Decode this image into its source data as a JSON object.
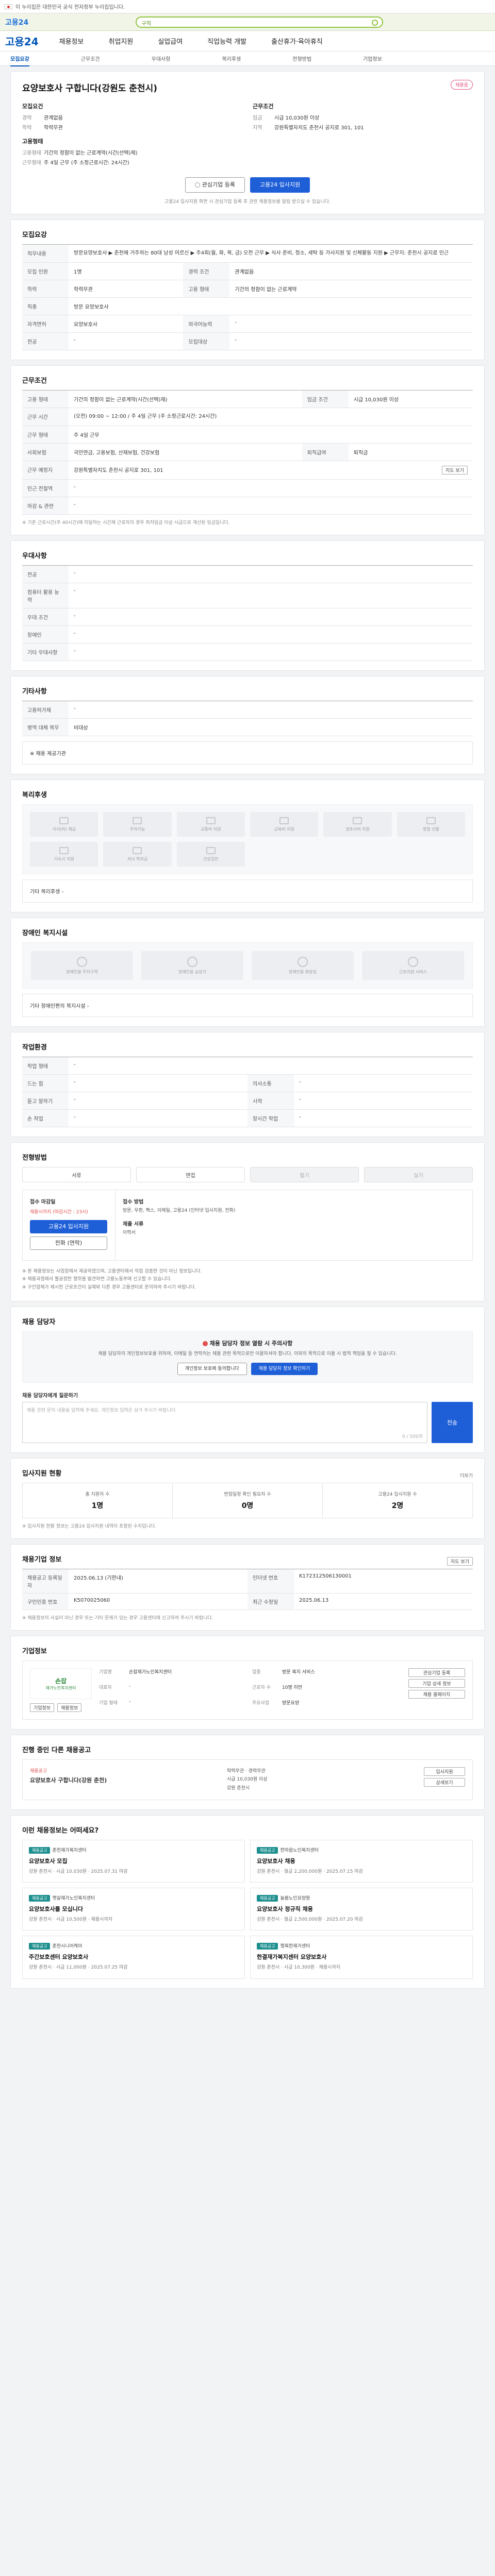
{
  "gov_banner": "이 누리집은 대한민국 공식 전자정부 누리집입니다.",
  "topbar": {
    "logo": "고용24",
    "search_label": "구직"
  },
  "gnb": {
    "logo": "고용24",
    "items": [
      "채용정보",
      "취업지원",
      "실업급여",
      "직업능력 개발",
      "출산휴가·육아휴직"
    ]
  },
  "subnav": {
    "items": [
      "모집요강",
      "근무조건",
      "우대사항",
      "복리후생",
      "전형방법",
      "기업정보"
    ],
    "active_index": 0
  },
  "header": {
    "title": "요양보호사 구합니다(강원도 춘천시)",
    "badge": "채용중",
    "recruit_title": "모집요건",
    "work_title": "근무조건",
    "recruit": [
      {
        "k": "경력",
        "v": "관계없음"
      },
      {
        "k": "학력",
        "v": "학력무관"
      }
    ],
    "work": [
      {
        "k": "임금",
        "v": "시급 10,030원 이상"
      },
      {
        "k": "지역",
        "v": "강원특별자치도 춘천시 공지로 301, 101"
      }
    ],
    "employ_title": "고용형태",
    "employ": [
      {
        "k": "고용형태",
        "v": "기간의 정함이 없는 근로계약(시간(선택)제)"
      },
      {
        "k": "근무형태",
        "v": "주 4일 근무 (주 소정근로시간: 24시간)"
      }
    ],
    "interest_button": "관심기업 등록",
    "apply_button": "고용24 입사지원",
    "note": "고용24 입사지원 화면 시 관심기업 등록 후 관련 채용정보를 알림 받으실 수 있습니다."
  },
  "recruit_section": {
    "title": "모집요강",
    "rows": [
      {
        "k": "직무내용",
        "v": "방문요양보호사 ▶ 춘천에 거주하는 80대 남성 어르신 ▶ 주4회(월, 화, 목, 금) 오전 근무 ▶ 식사 준비, 청소, 세탁 등 가사지원 및 신체활동 지원 ▶ 근무지: 춘천시 공지로 인근"
      },
      {
        "k": "모집 인원",
        "v": "1명"
      },
      {
        "k": "경력 조건",
        "v": "관계없음"
      },
      {
        "k": "학력",
        "v": "학력무관"
      },
      {
        "k": "고용 형태",
        "v": "기간의 정함이 없는 근로계약"
      },
      {
        "k": "직종",
        "v": "방문 요양보호사"
      },
      {
        "k": "자격면허",
        "v": "요양보호사"
      },
      {
        "k": "외국어능력",
        "v": "-"
      },
      {
        "k": "전공",
        "v": "-"
      },
      {
        "k": "모집대상",
        "v": "-"
      }
    ]
  },
  "work_section": {
    "title": "근무조건",
    "rows": [
      {
        "k": "고용 형태",
        "v": "기간의 정함이 없는 근로계약(시간(선택)제)"
      },
      {
        "k": "임금 조건",
        "v": "시급 10,030원 이상"
      },
      {
        "k": "근무 시간",
        "v": "(오전) 09:00 ~ 12:00 / 주 4일 근무 (주 소정근로시간: 24시간)"
      },
      {
        "k": "근무 형태",
        "v": "주 4일 근무"
      },
      {
        "k": "사회보험",
        "v": "국민연금, 고용보험, 산재보험, 건강보험"
      },
      {
        "k": "퇴직급여",
        "v": "퇴직금"
      },
      {
        "k": "근무 예정지",
        "v": "강원특별자치도 춘천시 공지로 301, 101"
      },
      {
        "k": "인근 전철역",
        "v": "-"
      },
      {
        "k": "마감 & 관련",
        "v": "-"
      }
    ],
    "map_button": "지도 보기",
    "note": "※ 기준 근로시간(주 40시간)에 미달하는 시간제 근로자의 경우 최저임금 이상 시급으로 계산된 임금입니다."
  },
  "prefer_section": {
    "title": "우대사항",
    "rows": [
      {
        "k": "전공",
        "v": "-"
      },
      {
        "k": "컴퓨터 활용 능력",
        "v": "-"
      },
      {
        "k": "우대 조건",
        "v": "-"
      },
      {
        "k": "장애인",
        "v": "-"
      },
      {
        "k": "기타 우대사항",
        "v": "-"
      }
    ]
  },
  "other_section": {
    "title": "기타사항",
    "rows": [
      {
        "k": "고용허가제",
        "v": "-"
      },
      {
        "k": "병역 대체 복무",
        "v": "비대상"
      }
    ],
    "ask_label": "※ 채용 제공기관"
  },
  "welfare_section": {
    "title": "복리후생",
    "items": [
      "식사(비) 제공",
      "주차가능",
      "교통비 지원",
      "교육비 지원",
      "경조사비 지원",
      "명절 선물",
      "기숙사 지원",
      "자녀 학자금",
      "건강검진"
    ],
    "etc_label": "기타 복리후생",
    "etc_value": "-"
  },
  "disabled_section": {
    "title": "장애인 복지시설",
    "items": [
      "장애인용 주차구역",
      "장애인용 승강기",
      "장애인용 화장실",
      "근로지원 서비스"
    ],
    "etc_label": "기타 장애인편의 복지시설",
    "etc_value": "-"
  },
  "env_section": {
    "title": "작업환경",
    "rows": [
      {
        "k": "작업 형태",
        "v": "-",
        "k2": "",
        "v2": ""
      },
      {
        "k": "드는 힘",
        "v": "-",
        "k2": "의사소통",
        "v2": "-"
      },
      {
        "k": "듣고 말하기",
        "v": "-",
        "k2": "시력",
        "v2": "-"
      },
      {
        "k": "손 작업",
        "v": "-",
        "k2": "장시간 작업",
        "v2": "-"
      }
    ]
  },
  "apply_section": {
    "title": "전형방법",
    "methods": [
      "서류",
      "면접",
      "필기",
      "실기"
    ],
    "method_dim": [
      false,
      false,
      true,
      true
    ],
    "apply_label": "접수 마감일",
    "apply_deadline": "채용시까지 (마감시간 : 23시)",
    "apply_button": "고용24 입사지원",
    "call_button": "전화 (연락)",
    "method_label": "접수 방법",
    "method_text": "방문, 우편, 팩스, 이메일, 고용24 (인터넷 입사지원, 전화)",
    "doc_label": "제출 서류",
    "doc_text": "이력서",
    "bullets": [
      "※ 본 채용정보는 사업장에서 제공하였으며, 고용센터에서 직접 검증한 것이 아닌 정보입니다.",
      "※ 채용과정에서 불공정한 행위를 발견하면 고용노동부에 신고할 수 있습니다.",
      "※ 구인업체가 제시한 근로조건이 실제와 다른 경우 고용센터로 문의하여 주시기 바랍니다."
    ]
  },
  "contact_section": {
    "title": "채용 담당자",
    "alert_title": "채용 담당자 정보 열람 시 주의사항",
    "alert_text": "채용 담당자의 개인정보보호를 위하여, 이메일 등 연락처는 채용 관련 목적으로만 이용하셔야 합니다. 이외의 목적으로 이용 시 법적 책임을 질 수 있습니다.",
    "button_agree": "개인정보 보호에 동의합니다",
    "button_view": "채용 담당자 정보 확인하기",
    "inquiry_label": "채용 담당자에게 질문하기",
    "inquiry_placeholder": "채용 관련 문의 내용을 입력해 주세요. 개인정보 입력은 삼가 주시기 바랍니다.",
    "inquiry_count": "0 / 500자",
    "inquiry_button": "전송"
  },
  "stats_section": {
    "title": "입사지원 현황",
    "more": "더보기",
    "items": [
      {
        "label": "총 지원자 수",
        "value": "1명"
      },
      {
        "label": "면접일정 확인 필요자 수",
        "value": "0명"
      },
      {
        "label": "고용24 입사지원 수",
        "value": "2명"
      }
    ],
    "note": "※ 입사지원 현황 정보는 고용24 입사지원 내역이 포함된 수치입니다."
  },
  "info_section": {
    "title": "채용기업 정보",
    "rows": [
      {
        "k": "채용공고 등록일자",
        "v": "2025.06.13 (기한내)",
        "k2": "인터넷 번호",
        "v2": "K172312506130001"
      },
      {
        "k": "구인인증 번호",
        "v": "K5070025060",
        "k2": "최근 수정일",
        "v2": "2025.06.13"
      }
    ],
    "map_button": "지도 보기",
    "note": "※ 채용정보의 사실이 아닌 경우 또는 기타 문제가 있는 경우 고용센터에 신고하여 주시기 바랍니다."
  },
  "company_section": {
    "title": "기업정보",
    "logo_mark": "손잡",
    "logo_sub": "재가노인복지센터",
    "fields": [
      {
        "k": "기업명",
        "v": "손잡재가노인복지센터"
      },
      {
        "k": "업종",
        "v": "방문 복지 서비스"
      },
      {
        "k": "대표자",
        "v": "-"
      },
      {
        "k": "근로자 수",
        "v": "10명 미만"
      },
      {
        "k": "기업 형태",
        "v": "-"
      },
      {
        "k": "주요사업",
        "v": "방문요양"
      }
    ],
    "buttons": [
      "기업정보",
      "채용정보",
      "채용 홈페이지"
    ],
    "side_buttons": [
      "관심기업 등록",
      "기업 상세 정보"
    ]
  },
  "other_jobs_section": {
    "title": "진행 중인 다른 채용공고",
    "company": "채용공고",
    "job_title": "요양보호사 구합니다(강원 춘천)",
    "meta": [
      "학력무관 · 경력무관",
      "시급 10,030원 이상",
      "강원 춘천시"
    ],
    "buttons": [
      "입사지원",
      "상세보기"
    ]
  },
  "recommend_section": {
    "title": "이런 채용정보는 어떠세요?",
    "cards": [
      {
        "badge": "채용공고",
        "company": "춘천재가복지센터",
        "title": "요양보호사 모집",
        "meta": "강원 춘천시 · 시급 10,030원 · 2025.07.31 마감"
      },
      {
        "badge": "채용공고",
        "company": "한마음노인복지센터",
        "title": "요양보호사 채용",
        "meta": "강원 춘천시 · 월급 2,200,000원 · 2025.07.15 마감"
      },
      {
        "badge": "채용공고",
        "company": "햇살재가노인복지센터",
        "title": "요양보호사를 모십니다",
        "meta": "강원 춘천시 · 시급 10,500원 · 채용시까지"
      },
      {
        "badge": "채용공고",
        "company": "늘봄노인요양원",
        "title": "요양보호사 정규직 채용",
        "meta": "강원 춘천시 · 월급 2,500,000원 · 2025.07.20 마감"
      },
      {
        "badge": "채용공고",
        "company": "춘천시니어케어",
        "title": "주간보호센터 요양보호사",
        "meta": "강원 춘천시 · 시급 11,000원 · 2025.07.25 마감"
      },
      {
        "badge": "채용공고",
        "company": "행복한재가센터",
        "title": "한결재가복지센터 요양보호사",
        "meta": "강원 춘천시 · 시급 10,300원 · 채용시까지"
      }
    ]
  }
}
